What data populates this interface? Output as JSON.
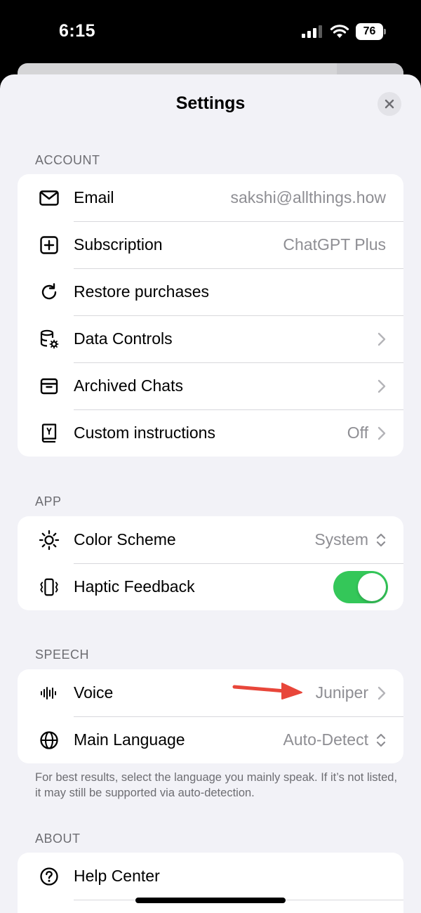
{
  "status": {
    "time": "6:15",
    "battery": "76"
  },
  "sheet": {
    "title": "Settings"
  },
  "account": {
    "label": "ACCOUNT",
    "rows": [
      {
        "label": "Email",
        "value": "sakshi@allthings.how",
        "icon": "mail-icon"
      },
      {
        "label": "Subscription",
        "value": "ChatGPT Plus",
        "icon": "plus-square-icon"
      },
      {
        "label": "Restore purchases",
        "icon": "refresh-icon"
      },
      {
        "label": "Data Controls",
        "icon": "database-gear-icon"
      },
      {
        "label": "Archived Chats",
        "icon": "archive-box-icon"
      },
      {
        "label": "Custom instructions",
        "value": "Off",
        "icon": "book-icon"
      }
    ]
  },
  "app": {
    "label": "APP",
    "rows": [
      {
        "label": "Color Scheme",
        "value": "System",
        "icon": "sun-icon"
      },
      {
        "label": "Haptic Feedback",
        "toggle_on": true,
        "icon": "haptic-phone-icon"
      }
    ]
  },
  "speech": {
    "label": "SPEECH",
    "rows": [
      {
        "label": "Voice",
        "value": "Juniper",
        "icon": "waveform-icon"
      },
      {
        "label": "Main Language",
        "value": "Auto-Detect",
        "icon": "globe-icon"
      }
    ],
    "footnote": "For best results, select the language you mainly speak. If it’s not listed, it may still be supported via auto-detection."
  },
  "about": {
    "label": "ABOUT",
    "rows": [
      {
        "label": "Help Center",
        "icon": "question-circle-icon"
      }
    ]
  },
  "colors": {
    "toggle_on": "#34c759",
    "annotation_arrow": "#e8463a"
  }
}
